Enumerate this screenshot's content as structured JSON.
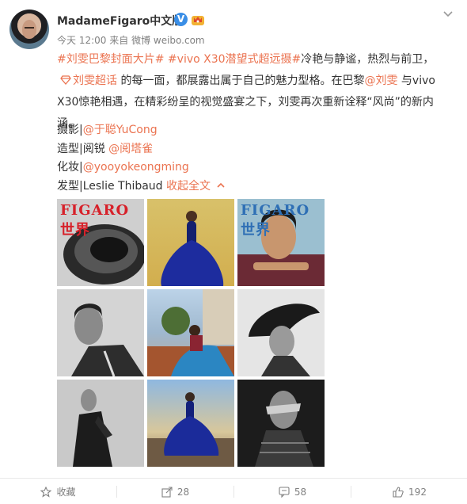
{
  "post": {
    "username": "MadameFigaro中文版",
    "verified_badge": "V",
    "time": "今天 12:00",
    "source_prefix": "来自",
    "source": "微博 weibo.com",
    "avatar_caption": "figaro",
    "text": {
      "tag1": "#刘雯巴黎封面大片#",
      "tag2": "#vivo X30潜望式超远摄#",
      "seg1": "冷艳与静谧，热烈与前卫，",
      "link_topic": "刘雯超话",
      "seg2": " 的每一面，都展露出属于自己的魅力型格。在巴黎",
      "mention": "@刘雯",
      "seg3": " 与vivo X30惊艳相遇，在精彩纷呈的视觉盛宴之下，刘雯再次重新诠释“风尚”的新内涵。"
    },
    "credits": [
      {
        "label": "摄影|",
        "mention": "@于聪YuCong"
      },
      {
        "label": "造型|阅锐 ",
        "mention": "@阅塔雀"
      },
      {
        "label": "化妆|",
        "mention": "@yooyokeongming"
      },
      {
        "label": "发型|Leslie Thibaud ",
        "mention": "收起全文"
      }
    ],
    "images": [
      {
        "caption": "FIGARO世界",
        "color": "#d7212a"
      },
      {
        "caption": ""
      },
      {
        "caption": "FIGARO世界",
        "color": "#2e6fb5"
      },
      {
        "caption": ""
      },
      {
        "caption": ""
      },
      {
        "caption": ""
      },
      {
        "caption": ""
      },
      {
        "caption": ""
      },
      {
        "caption": ""
      }
    ]
  },
  "actions": {
    "favorite": "收藏",
    "repost": "28",
    "comment": "58",
    "like": "192"
  },
  "icons": {
    "topic": "diamond-topic-icon",
    "collapse": "chevron-up-icon",
    "menu": "chevron-down-icon"
  },
  "colors": {
    "link": "#eb7350",
    "muted": "#808080",
    "verified": "#3a8ee6"
  }
}
